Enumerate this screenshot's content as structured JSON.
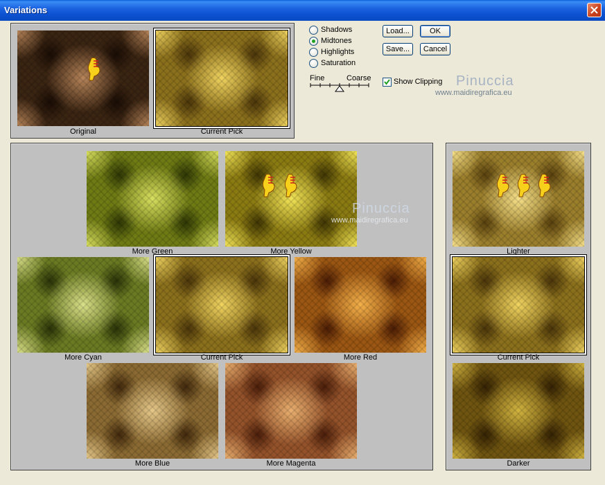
{
  "window": {
    "title": "Variations"
  },
  "original": {
    "label": "Original",
    "current_label": "Current Pick"
  },
  "options": {
    "radios": [
      {
        "label": "Shadows",
        "checked": false
      },
      {
        "label": "Midtones",
        "checked": true
      },
      {
        "label": "Highlights",
        "checked": false
      },
      {
        "label": "Saturation",
        "checked": false
      }
    ],
    "slider": {
      "fine_label": "Fine",
      "coarse_label": "Coarse"
    },
    "show_clipping": {
      "label": "Show Clipping",
      "checked": true
    }
  },
  "buttons": {
    "load": "Load...",
    "ok": "OK",
    "save": "Save...",
    "cancel": "Cancel"
  },
  "watermark": {
    "name": "Pinuccia",
    "url": "www.maidiregrafica.eu"
  },
  "color_grid": {
    "more_green": "More Green",
    "more_yellow": "More Yellow",
    "more_cyan": "More Cyan",
    "current_pick": "Current Pick",
    "more_red": "More Red",
    "more_blue": "More Blue",
    "more_magenta": "More Magenta"
  },
  "brightness": {
    "lighter": "Lighter",
    "current_pick": "Current Pick",
    "darker": "Darker"
  },
  "colors": {
    "title_bar": "#1b63e0",
    "dialog_bg": "#ece9d8",
    "panel_bg": "#c0c0c0"
  },
  "icons": {
    "close": "close-icon",
    "pointing_hand": "pointing-hand-icon"
  }
}
